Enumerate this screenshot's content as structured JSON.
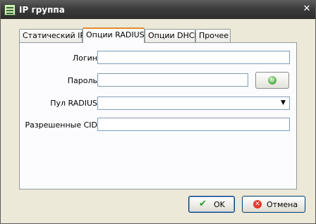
{
  "window": {
    "title": "IP группа",
    "title_icon": "grid-app-icon",
    "close_glyph": "✕"
  },
  "tabs": [
    {
      "label": "Статический IP",
      "active": false
    },
    {
      "label": "Опции RADIUS",
      "active": true
    },
    {
      "label": "Опции DHCP",
      "active": false
    },
    {
      "label": "Прочее",
      "active": false
    }
  ],
  "form": {
    "login": {
      "label": "Логин",
      "value": ""
    },
    "password": {
      "label": "Пароль",
      "value": "",
      "generate_icon": "generate-password-icon"
    },
    "radius_pool": {
      "label": "Пул RADIUS",
      "value": ""
    },
    "allowed_cid": {
      "label": "Разрешенные CID",
      "value": ""
    }
  },
  "buttons": {
    "ok": {
      "label": "OK",
      "icon": "checkmark-icon"
    },
    "cancel": {
      "label": "Отмена",
      "icon": "cancel-icon"
    }
  },
  "colors": {
    "titlebar": "#3b3b3b",
    "active_tab_accent": "#e68b2c",
    "field_border": "#7f9db9",
    "window_bg": "#ece9d8"
  }
}
